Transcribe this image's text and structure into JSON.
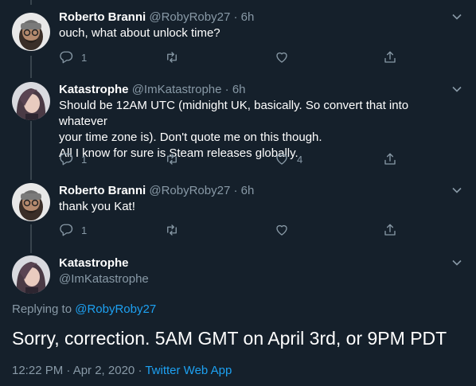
{
  "tweets": [
    {
      "name": "Roberto Branni",
      "handle": "@RobyRoby27",
      "dot": "·",
      "time": "6h",
      "lines": [
        "ouch, what about unlock time?"
      ],
      "reply_count": "1",
      "retweet_count": "",
      "like_count": ""
    },
    {
      "name": "Katastrophe",
      "handle": "@ImKatastrophe",
      "dot": "·",
      "time": "6h",
      "lines": [
        "Should be 12AM UTC (midnight UK, basically. So convert that into whatever",
        "your time zone is). Don't quote me on this though.",
        "All I know for sure is Steam releases globally."
      ],
      "reply_count": "1",
      "retweet_count": "",
      "like_count": "4"
    },
    {
      "name": "Roberto Branni",
      "handle": "@RobyRoby27",
      "dot": "·",
      "time": "6h",
      "lines": [
        "thank you Kat!"
      ],
      "reply_count": "1",
      "retweet_count": "",
      "like_count": ""
    }
  ],
  "main": {
    "name": "Katastrophe",
    "handle": "@ImKatastrophe",
    "replying_prefix": "Replying to",
    "replying_handle": "@RobyRoby27",
    "text": "Sorry, correction. 5AM GMT on April 3rd, or 9PM PDT",
    "timestamp": "12:22 PM · Apr 2, 2020",
    "sep": "·",
    "source": "Twitter Web App"
  },
  "colors": {
    "background": "#15202b",
    "muted": "#8899a6",
    "accent": "#1da1f2",
    "divider": "#38444d"
  },
  "icons": [
    "reply-icon",
    "retweet-icon",
    "like-icon",
    "share-icon",
    "chevron-down-icon"
  ]
}
